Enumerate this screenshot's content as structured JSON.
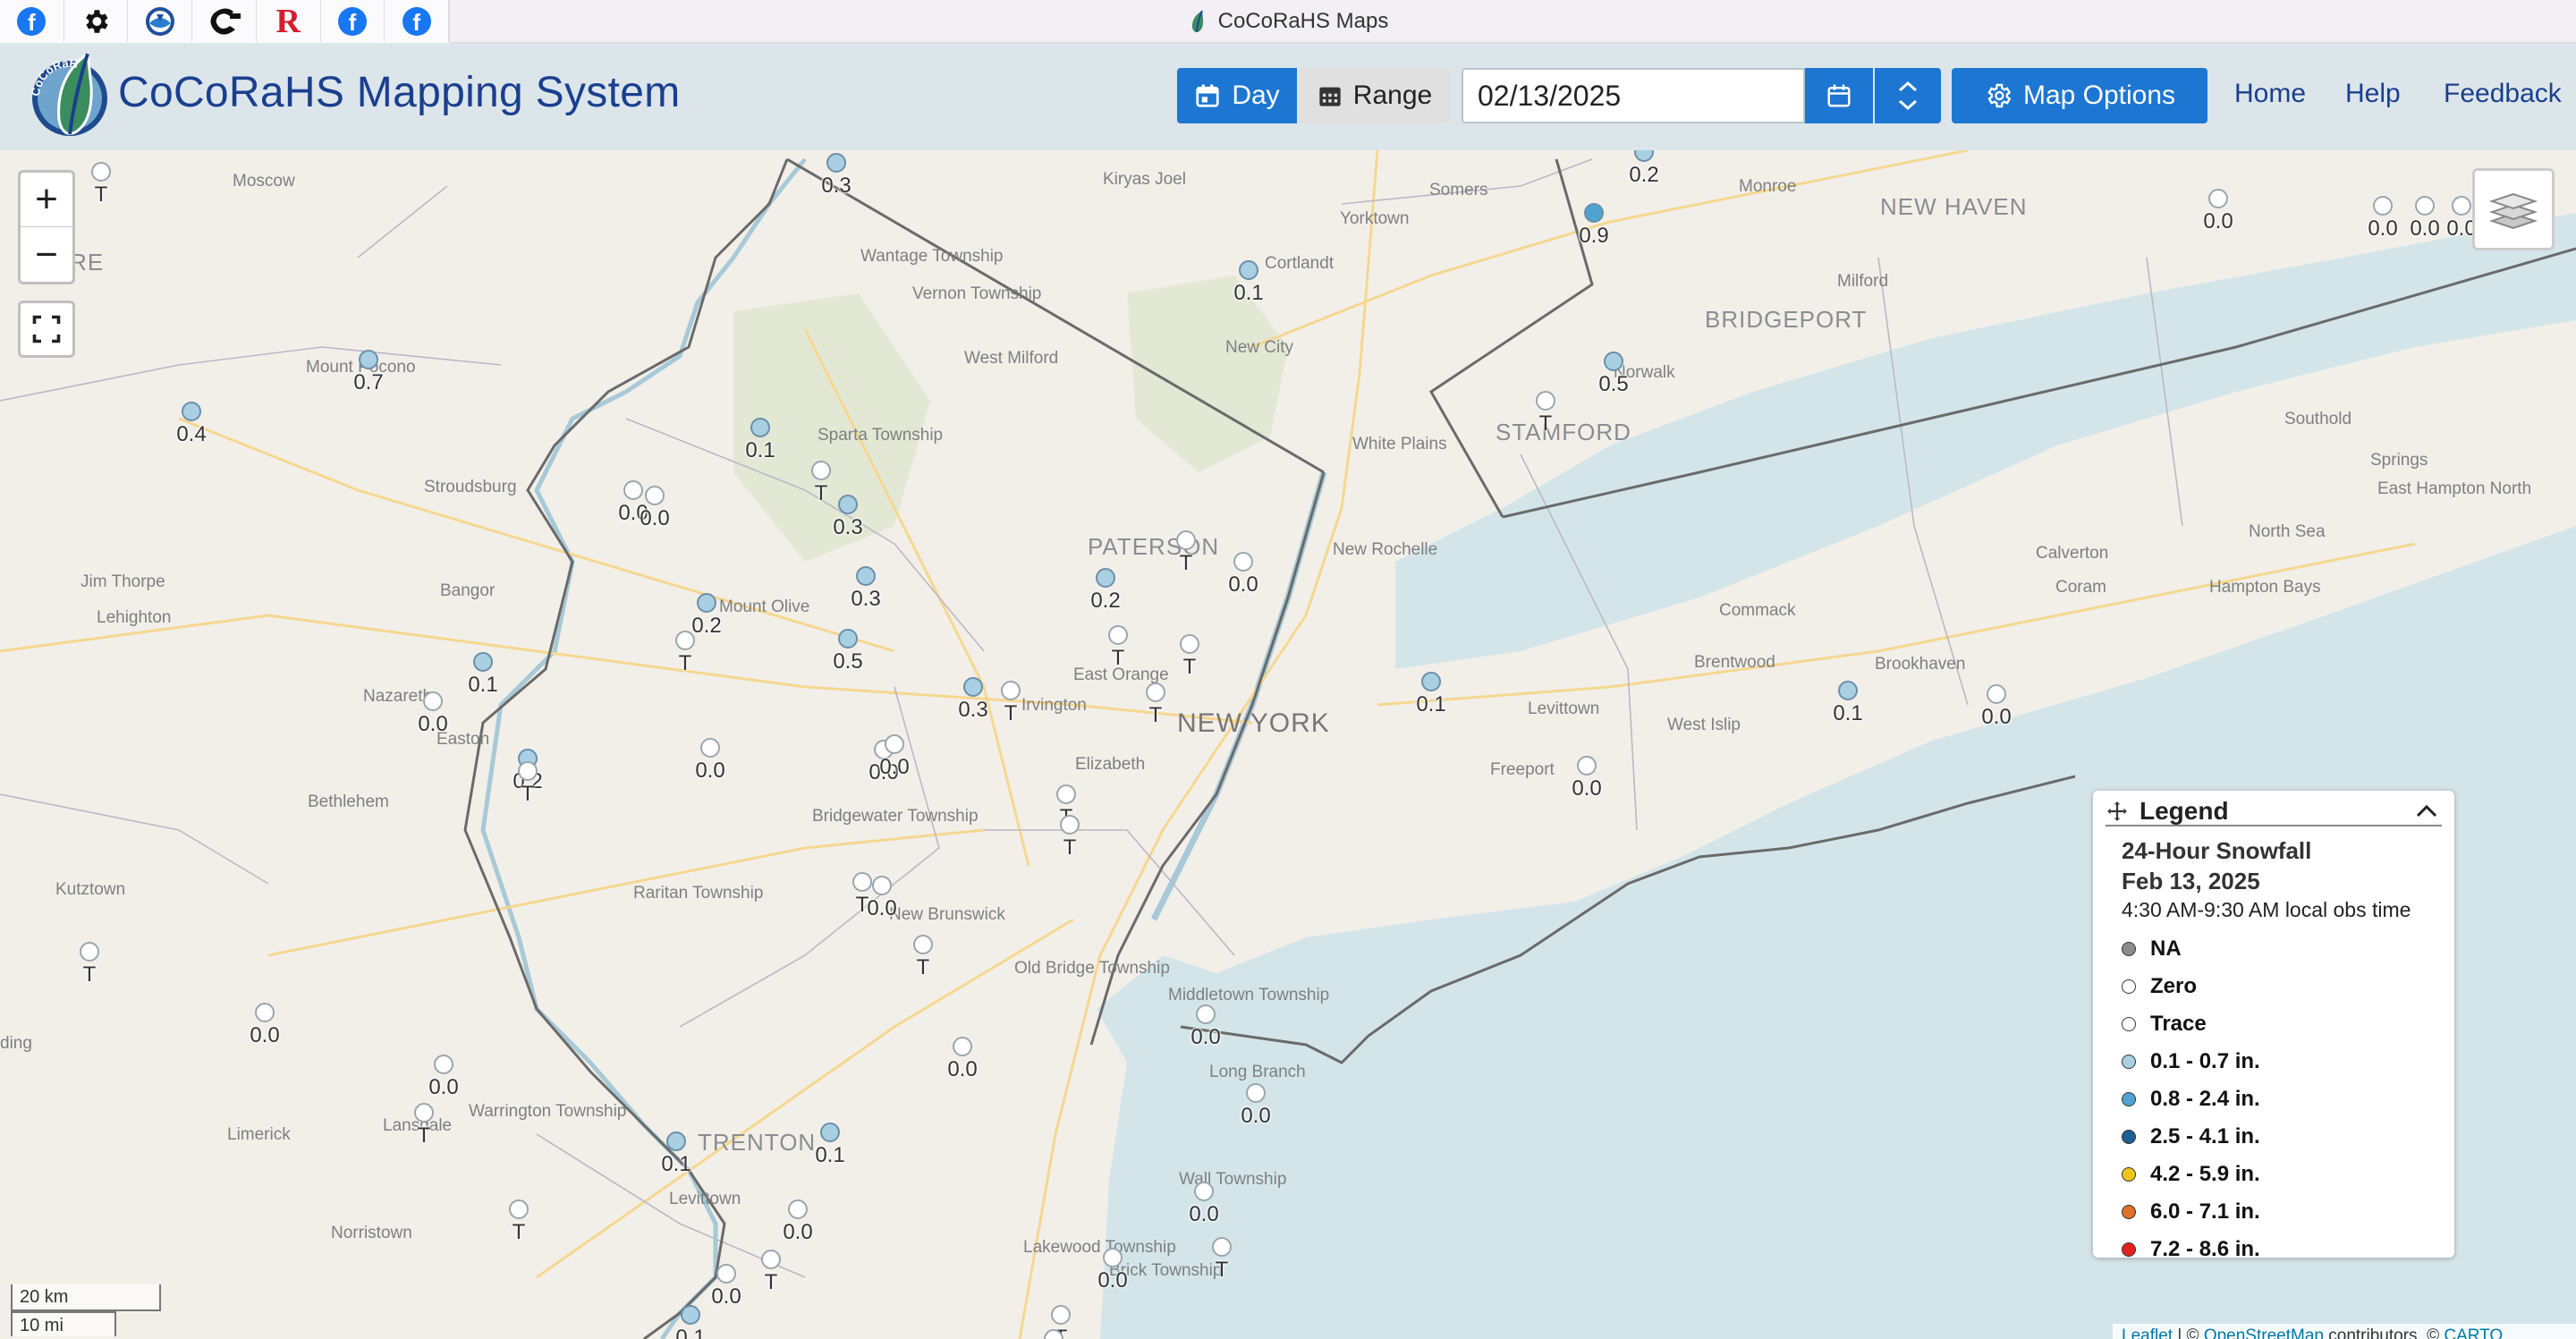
{
  "window": {
    "title": "CoCoRaHS Maps"
  },
  "bookmarks": [
    {
      "name": "facebook-icon"
    },
    {
      "name": "gear-icon"
    },
    {
      "name": "noaa-icon"
    },
    {
      "name": "c-logo-icon"
    },
    {
      "name": "r-logo-icon",
      "text": "R"
    },
    {
      "name": "facebook-icon"
    },
    {
      "name": "facebook-icon"
    }
  ],
  "header": {
    "title": "CoCoRaHS Mapping System",
    "logo_text": "CoCoRaHS",
    "day_label": "Day",
    "range_label": "Range",
    "date_value": "02/13/2025",
    "map_options_label": "Map Options",
    "nav": {
      "home": "Home",
      "help": "Help",
      "feedback": "Feedback"
    }
  },
  "map": {
    "place_labels": [
      "Moscow",
      "Kiryas Joel",
      "Somers",
      "Monroe",
      "NEW HAVEN",
      "Wantage Township",
      "Vernon Township",
      "Cortlandt",
      "Yorktown",
      "Milford",
      "BRIDGEPORT",
      "West Milford",
      "New City",
      "Mount Pocono",
      "Norwalk",
      "STAMFORD",
      "Sparta Township",
      "White Plains",
      "Stroudsburg",
      "Southold",
      "Springs",
      "East Hampton North",
      "North Sea",
      "Calverton",
      "PATERSON",
      "New Rochelle",
      "Jim Thorpe",
      "Bangor",
      "Lehighton",
      "Mount Olive",
      "Coram",
      "Hampton Bays",
      "Commack",
      "East Orange",
      "Irvington",
      "Nazareth",
      "NEW YORK",
      "Brentwood",
      "Brookhaven",
      "Levittown",
      "West Islip",
      "Easton",
      "Elizabeth",
      "Freeport",
      "Bethlehem",
      "Bridgewater Township",
      "Kutztown",
      "Raritan Township",
      "New Brunswick",
      "Old Bridge Township",
      "Middletown Township",
      "Long Branch",
      "Warrington Township",
      "Lansdale",
      "Limerick",
      "TRENTON",
      "Wall Township",
      "Levittown",
      "Norristown",
      "Lakewood Township",
      "Brick Township",
      "ding",
      "ERRE"
    ],
    "stations": [
      "T",
      "0.3",
      "0.2",
      "0.9",
      "0.0",
      "0.0",
      "0.0",
      "0.0",
      "0.1",
      "0.7",
      "0.4",
      "0.5",
      "T",
      "0.1",
      "T",
      "0.3",
      "0.0",
      "0.0",
      "T",
      "0.3",
      "0.2",
      "0.2",
      "T",
      "T",
      "0.0",
      "T",
      "0.1",
      "0.5",
      "0.3",
      "T",
      "0.1",
      "T",
      "0.0",
      "0.0",
      "0.0",
      "0.0",
      "0.1",
      "0.0",
      "0.2",
      "0.0",
      "T",
      "T",
      "T",
      "0.0",
      "T",
      "T",
      "0.0",
      "0.0",
      "0.0",
      "T",
      "0.0",
      "0.0",
      "T",
      "0.1",
      "0.1",
      "T",
      "0.0",
      "0.0",
      "0.0",
      "T",
      "0.0",
      "T",
      "T",
      "0.1",
      "T"
    ],
    "scale": {
      "km": "20 km",
      "mi": "10 mi"
    },
    "attribution": {
      "leaflet": "Leaflet",
      "sep": " | © ",
      "osm": "OpenStreetMap",
      "contrib": " contributors, © ",
      "carto": "CARTO"
    }
  },
  "legend": {
    "title": "Legend",
    "product": "24-Hour Snowfall",
    "date": "Feb 13, 2025",
    "obs_time": "4:30 AM-9:30 AM local obs time",
    "items": [
      {
        "label": "NA",
        "color": "#8c8c8c"
      },
      {
        "label": "Zero",
        "color": "#ffffff"
      },
      {
        "label": "Trace",
        "color": "#ffffff"
      },
      {
        "label": "0.1 - 0.7 in.",
        "color": "#a9cfe3"
      },
      {
        "label": "0.8 - 2.4 in.",
        "color": "#4fa4cf"
      },
      {
        "label": "2.5 - 4.1 in.",
        "color": "#1d5f96"
      },
      {
        "label": "4.2 - 5.9 in.",
        "color": "#f0c419"
      },
      {
        "label": "6.0 - 7.1 in.",
        "color": "#e0702a"
      },
      {
        "label": "7.2 - 8.6 in.",
        "color": "#e0221e"
      }
    ]
  },
  "colors": {
    "accent": "#1d76d2",
    "header_bg": "#dce6ea",
    "title": "#1a3f8f",
    "water": "#d4e5ea",
    "land": "#f2efe9"
  }
}
